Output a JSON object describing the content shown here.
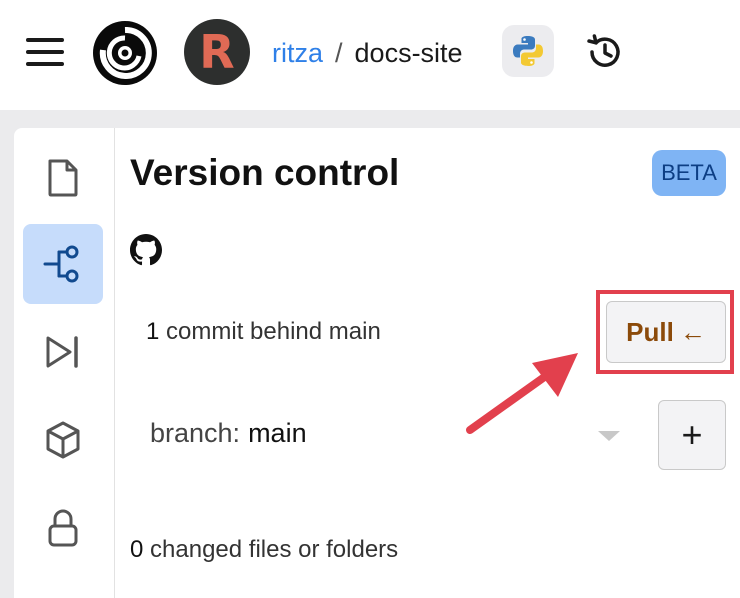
{
  "header": {
    "owner": "ritza",
    "separator": "/",
    "repo": "docs-site",
    "avatar_letter": "R",
    "icons": [
      "menu-icon",
      "app-logo",
      "python-icon",
      "history-icon"
    ]
  },
  "rail": {
    "items": [
      {
        "name": "files",
        "icon": "file-icon",
        "active": false
      },
      {
        "name": "version-control",
        "icon": "git-branch-icon",
        "active": true
      },
      {
        "name": "run",
        "icon": "play-skip-icon",
        "active": false
      },
      {
        "name": "packages",
        "icon": "cube-icon",
        "active": false
      },
      {
        "name": "secrets",
        "icon": "lock-icon",
        "active": false
      }
    ]
  },
  "version_control": {
    "title": "Version control",
    "badge": "BETA",
    "provider_icon": "github-icon",
    "commit_count": "1",
    "commit_text": "commit behind main",
    "pull_label": "Pull",
    "pull_arrow": "←",
    "branch_prefix": "branch:",
    "branch_value": "main",
    "add_branch_label": "+",
    "changed_count": "0",
    "changed_text": "changed files or folders"
  },
  "colors": {
    "accent": "#2f80e8",
    "active_rail": "#c6dcfb",
    "beta_bg": "#7fb4f4",
    "pull_text": "#8b4a0a",
    "highlight": "#e2404d"
  }
}
